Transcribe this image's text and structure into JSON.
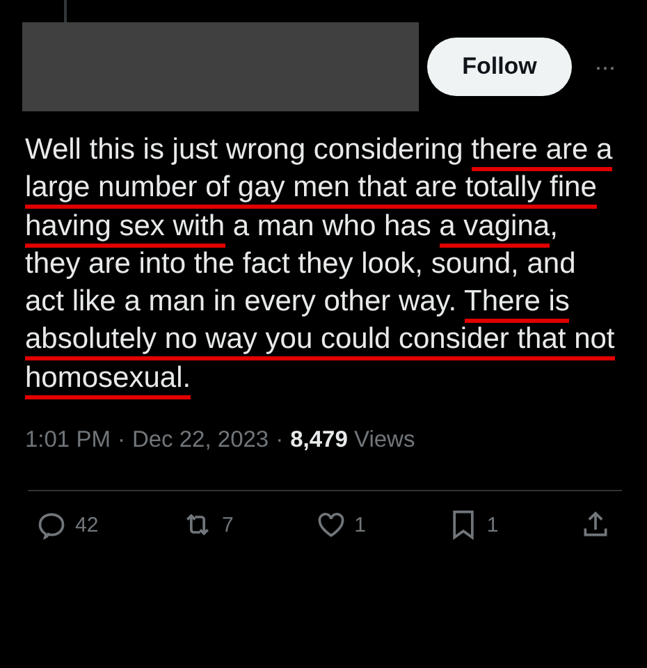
{
  "header": {
    "follow_button": "Follow",
    "more": "···"
  },
  "tweet": {
    "segments": [
      {
        "text": "Well this is just wrong considering ",
        "underlined": false
      },
      {
        "text": "there ",
        "underlined": true
      },
      {
        "text": "are a large number of gay men that are ",
        "underlined": true
      },
      {
        "text": "totally fine having sex with",
        "underlined": true
      },
      {
        "text": " a man who has ",
        "underlined": false
      },
      {
        "text": "a vagina",
        "underlined": true
      },
      {
        "text": ", they are into the fact they look, sound, and act like a man in every other way. ",
        "underlined": false
      },
      {
        "text": "There is absolutely no way you could consider that not homosexual.",
        "underlined": true
      }
    ]
  },
  "meta": {
    "separator": "·",
    "time": "1:01 PM",
    "date": "Dec 22, 2023",
    "views_count": "8,479",
    "views_label": "Views"
  },
  "actions": [
    {
      "kind": "reply",
      "count": "42"
    },
    {
      "kind": "repost",
      "count": "7"
    },
    {
      "kind": "like",
      "count": "1"
    },
    {
      "kind": "bookmark",
      "count": "1"
    },
    {
      "kind": "share"
    }
  ]
}
